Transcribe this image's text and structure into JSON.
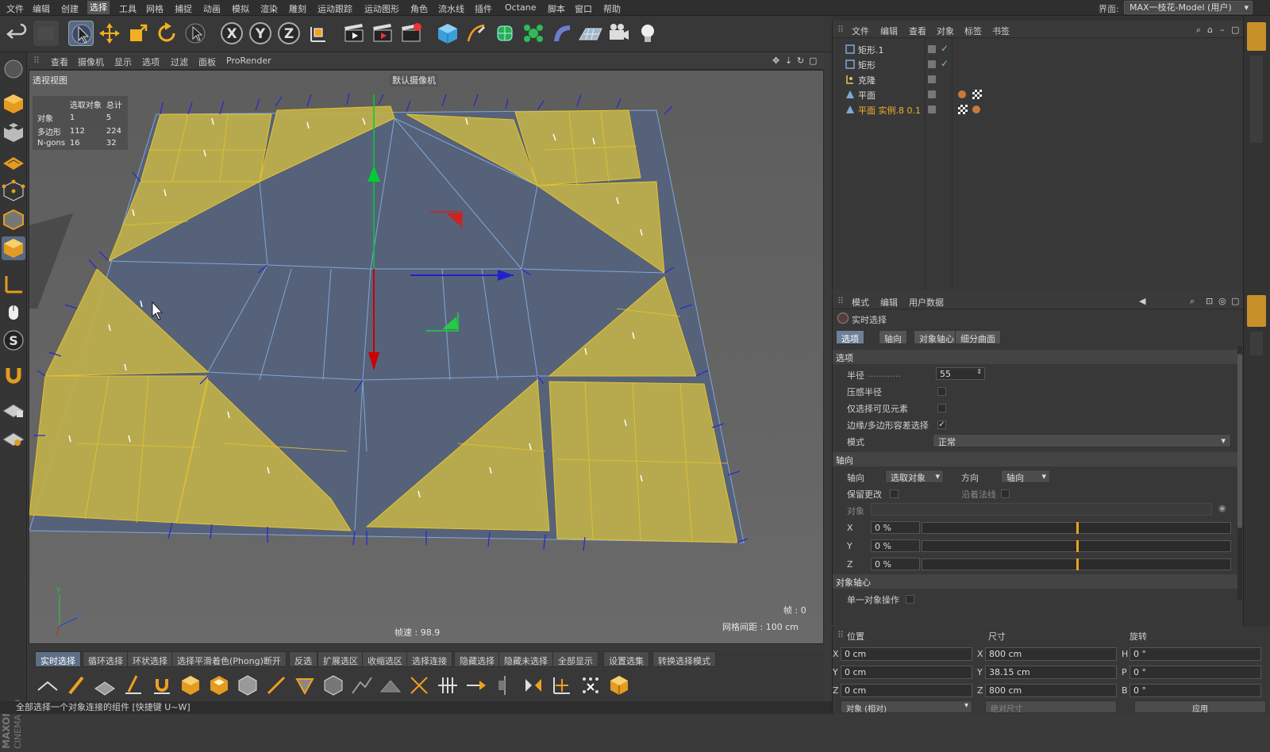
{
  "menubar": {
    "items": [
      "文件",
      "编辑",
      "创建",
      "选择",
      "工具",
      "网格",
      "捕捉",
      "动画",
      "模拟",
      "渲染",
      "雕刻",
      "运动跟踪",
      "运动图形",
      "角色",
      "流水线",
      "插件",
      "Octane",
      "脚本",
      "窗口",
      "帮助"
    ],
    "active": "选择",
    "interface_label": "界面:",
    "interface_value": "MAX一枝花-Model (用户)"
  },
  "viewport": {
    "menu": [
      "查看",
      "摄像机",
      "显示",
      "选项",
      "过滤",
      "面板",
      "ProRender"
    ],
    "view_name": "透视视图",
    "camera": "默认摄像机",
    "hud": {
      "col1": "选取对象",
      "col2": "总计",
      "rows": [
        {
          "label": "对象",
          "sel": "1",
          "total": "5"
        },
        {
          "label": "多边形",
          "sel": "112",
          "total": "224"
        },
        {
          "label": "N-gons",
          "sel": "16",
          "total": "32"
        }
      ]
    },
    "fps": "帧速 : 98.9",
    "frame": "帧 : 0",
    "grid": "网格间距 : 100 cm",
    "colors": {
      "bg": "#5f5f5f",
      "selected": "#bfb04a",
      "mesh": "#5b6678",
      "edge": "#7fa8d8",
      "normal": "#2a2acc"
    }
  },
  "bottom_tabs": [
    "实时选择",
    "循环选择",
    "环状选择",
    "选择平滑着色(Phong)断开",
    "反选",
    "扩展选区",
    "收缩选区",
    "选择连接",
    "隐藏选择",
    "隐藏未选择",
    "全部显示",
    "设置选集",
    "转换选择模式"
  ],
  "status": "全部选择一个对象连接的组件 [快捷键 U~W]",
  "branding": "MAXON CINEMA 4D",
  "object_manager": {
    "menu": [
      "文件",
      "编辑",
      "查看",
      "对象",
      "标签",
      "书签"
    ],
    "objects": [
      {
        "name": "矩形.1",
        "icon": "rectangle-icon",
        "checked": true,
        "highlight": false
      },
      {
        "name": "矩形",
        "icon": "rectangle-icon",
        "checked": true,
        "highlight": false
      },
      {
        "name": "克隆",
        "icon": "cloner-icon",
        "checked": false,
        "highlight": false
      },
      {
        "name": "平面",
        "icon": "plane-icon",
        "checked": false,
        "highlight": false
      },
      {
        "name": "平面 实例.8 0.1",
        "icon": "plane-icon",
        "checked": false,
        "highlight": true
      }
    ]
  },
  "attribute_manager": {
    "menu": [
      "模式",
      "编辑",
      "用户数据"
    ],
    "tool_name": "实时选择",
    "tabs": [
      "选项",
      "轴向",
      "对象轴心",
      "细分曲面"
    ],
    "active_tab": "选项",
    "sections": {
      "options": "选项",
      "axis": "轴向",
      "pivot": "对象轴心"
    },
    "options": {
      "radius_label": "半径",
      "radius_value": "55",
      "pressure_label": "压感半径",
      "visible_only_label": "仅选择可见元素",
      "tolerance_label": "边缘/多边形容差选择",
      "mode_label": "模式",
      "mode_value": "正常"
    },
    "axis": {
      "axis_label": "轴向",
      "axis_value": "选取对象",
      "dir_label": "方向",
      "dir_value": "轴向",
      "keep_label": "保留更改",
      "along_normal_label": "沿着法线",
      "object_label": "对象",
      "x_label": "X",
      "x_value": "0 %",
      "x_level": 0.5,
      "y_label": "Y",
      "y_value": "0 %",
      "y_level": 0.5,
      "z_label": "Z",
      "z_value": "0 %",
      "z_level": 0.5
    },
    "pivot": {
      "single_label": "单一对象操作"
    }
  },
  "coordinates": {
    "headers": [
      "位置",
      "尺寸",
      "旋转"
    ],
    "rows": [
      {
        "pos_axis": "X",
        "pos": "0 cm",
        "size_axis": "X",
        "size": "800 cm",
        "rot_axis": "H",
        "rot": "0 °"
      },
      {
        "pos_axis": "Y",
        "pos": "0 cm",
        "size_axis": "Y",
        "size": "38.15 cm",
        "rot_axis": "P",
        "rot": "0 °"
      },
      {
        "pos_axis": "Z",
        "pos": "0 cm",
        "size_axis": "Z",
        "size": "800 cm",
        "rot_axis": "B",
        "rot": "0 °"
      }
    ],
    "mode": "对象 (相对)",
    "size_mode": "绝对尺寸",
    "apply": "应用"
  }
}
